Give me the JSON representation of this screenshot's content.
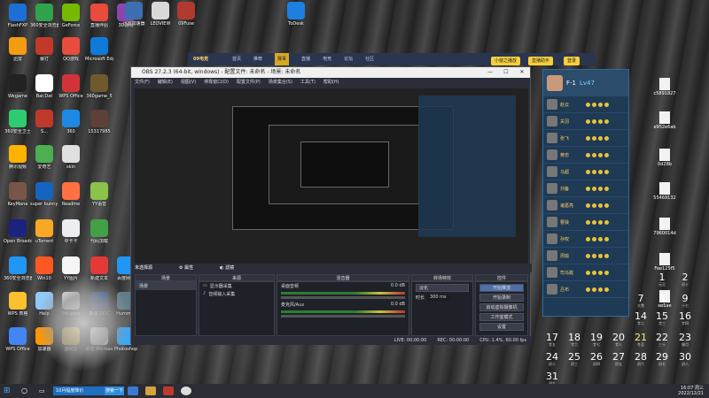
{
  "desktop": {
    "left_icons": [
      {
        "label": "FlashFXP"
      },
      {
        "label": "360安全浏览器"
      },
      {
        "label": "GeForce"
      },
      {
        "label": "直播伴侣"
      },
      {
        "label": "3D游戏"
      },
      {
        "label": "迅雷"
      },
      {
        "label": "暴打"
      },
      {
        "label": "QQ游戏"
      },
      {
        "label": "Microsoft Edge"
      },
      {
        "label": "Wegame"
      },
      {
        "label": "Bar.Dat"
      },
      {
        "label": "WPS Office"
      },
      {
        "label": "360game_5"
      },
      {
        "label": "360安全卫士"
      },
      {
        "label": "S..."
      },
      {
        "label": "360"
      },
      {
        "label": "15317985"
      },
      {
        "label": "腾讯视频"
      },
      {
        "label": "爱奇艺"
      },
      {
        "label": "skin"
      },
      {
        "label": "KeyMana"
      },
      {
        "label": "super bunny man"
      },
      {
        "label": "Readme"
      },
      {
        "label": "YY语音"
      },
      {
        "label": "Open Broadcast"
      },
      {
        "label": "uTorrent"
      },
      {
        "label": "中卡卡"
      },
      {
        "label": "代码加载"
      },
      {
        "label": "360安全浏览器"
      },
      {
        "label": "Win10"
      },
      {
        "label": "YY图片"
      },
      {
        "label": "新建文本"
      },
      {
        "label": "WPS 表格"
      },
      {
        "label": "Help"
      },
      {
        "label": "09Uploa"
      },
      {
        "label": "新建 DOC"
      },
      {
        "label": "WPS Office"
      },
      {
        "label": "加速器"
      },
      {
        "label": "游戏盒"
      },
      {
        "label": "新建 Microso"
      },
      {
        "label": "Photoshop"
      },
      {
        "label": "Hummer"
      },
      {
        "label": "百度网盘"
      }
    ],
    "top_icons": [
      {
        "label": "LEOVIEW"
      },
      {
        "label": "09Fuse"
      },
      {
        "label": "迅雷加速器"
      },
      {
        "label": "ToDesk"
      }
    ]
  },
  "browser_bar": {
    "site": "09电竞",
    "tabs": [
      "首页",
      "推荐",
      "赛事",
      "直播",
      "电竞",
      "论坛",
      "社区"
    ],
    "buttons": [
      "小窗之播放",
      "直播助手",
      "登录"
    ]
  },
  "obs": {
    "title": "OBS 27.2.3 (64-bit, windows) - 配置文件: 未命名 - 场景: 未命名",
    "menu": [
      "文件(F)",
      "编辑(E)",
      "视图(V)",
      "停靠窗口(D)",
      "配置文件(P)",
      "场景集合(S)",
      "工具(T)",
      "帮助(H)"
    ],
    "scene_bar": "未选择源",
    "properties": "属性",
    "filters": "滤镜",
    "docks": {
      "scenes": {
        "title": "场景",
        "items": [
          "场景"
        ]
      },
      "sources": {
        "title": "来源",
        "items": [
          "显示器采集",
          "音频输入采集"
        ]
      },
      "mixer": {
        "title": "混音器",
        "tracks": [
          "桌面音频",
          "麦克风/Aux"
        ],
        "db": [
          "0.0 dB",
          "0.0 dB"
        ]
      },
      "transitions": {
        "title": "转场特效",
        "type": "淡化",
        "duration_label": "时长",
        "duration": "300 ms"
      },
      "controls": {
        "title": "控件",
        "buttons": [
          "开始推流",
          "开始录制",
          "启动虚拟摄像机",
          "工作室模式",
          "设置",
          "退出"
        ]
      }
    },
    "status": {
      "live": "LIVE: 00:00:00",
      "rec": "REC: 00:00:00",
      "cpu": "CPU: 1.4%, 60.00 fps"
    }
  },
  "panel": {
    "user": "F-1",
    "tag": "Lv47",
    "players": [
      {
        "name": "赵云"
      },
      {
        "name": "关羽"
      },
      {
        "name": "张飞"
      },
      {
        "name": "黄忠"
      },
      {
        "name": "马超"
      },
      {
        "name": "刘备"
      },
      {
        "name": "诸葛亮"
      },
      {
        "name": "曹操"
      },
      {
        "name": "孙权"
      },
      {
        "name": "周瑜"
      },
      {
        "name": "司马懿"
      },
      {
        "name": "吕布"
      }
    ]
  },
  "right_icons": [
    {
      "label": "c5891827"
    },
    {
      "label": "e952e6ab"
    },
    {
      "label": "0d28b"
    },
    {
      "label": "55469132"
    },
    {
      "label": "7960014d"
    },
    {
      "label": "Fee125f5"
    },
    {
      "label": "ce1ae"
    }
  ],
  "calendar": {
    "head": "日 一 二 三 四 五 六",
    "days": [
      {
        "n": "1",
        "s": "元旦"
      },
      {
        "n": "2",
        "s": "初十"
      },
      {
        "n": "7",
        "s": "大雪"
      },
      {
        "n": "8",
        "s": "十六"
      },
      {
        "n": "9",
        "s": "十七"
      },
      {
        "n": "14",
        "s": "廿二"
      },
      {
        "n": "15",
        "s": "廿三"
      },
      {
        "n": "16",
        "s": "廿四"
      },
      {
        "n": "17",
        "s": "廿五"
      },
      {
        "n": "18",
        "s": "廿六"
      },
      {
        "n": "19",
        "s": "廿七"
      },
      {
        "n": "20",
        "s": "廿八"
      },
      {
        "n": "21",
        "s": "冬至"
      },
      {
        "n": "22",
        "s": "三十"
      },
      {
        "n": "23",
        "s": "腊月"
      },
      {
        "n": "24",
        "s": "初二"
      },
      {
        "n": "25",
        "s": "初三"
      },
      {
        "n": "26",
        "s": "初四"
      },
      {
        "n": "27",
        "s": "初五"
      },
      {
        "n": "28",
        "s": "初六"
      },
      {
        "n": "29",
        "s": "初七"
      },
      {
        "n": "30",
        "s": "初八"
      },
      {
        "n": "31",
        "s": "初九"
      }
    ]
  },
  "taskbar": {
    "search_text": "10月幅度降价",
    "search_btn": "搜索一下",
    "time": "16:07 周三",
    "date": "2022/12/21"
  },
  "colors": {
    "obs_bg": "#2b2e38",
    "taskbar": "#2a2d33",
    "panel": "#1f3a55",
    "accent": "#f6cf3a"
  }
}
